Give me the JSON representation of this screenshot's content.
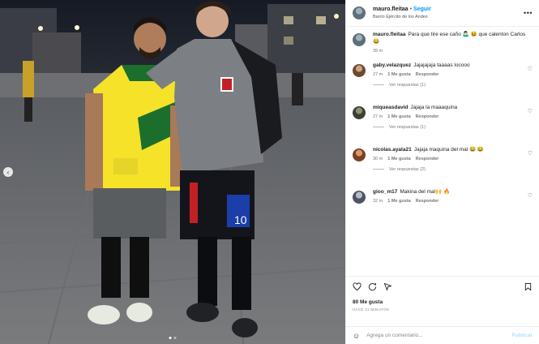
{
  "header": {
    "username": "mauro.fleitaa",
    "separator": "•",
    "follow_label": "Seguir",
    "location": "Barrio Ejército de los Andes",
    "more_icon": "more-horizontal-icon"
  },
  "caption": {
    "username": "mauro.fleitaa",
    "text": "Para que tire ese caño 🤷🏻‍♂️ 😆 que calenton Carlos 😂",
    "time": "39 m"
  },
  "comments": [
    {
      "username": "gaby.velazquez",
      "text": "Jajajajaja taaaas locooo",
      "time": "27 m",
      "likes": "1 Me gusta",
      "reply": "Responder",
      "replies": "Ver respuestas (1)"
    },
    {
      "username": "miqueasdavid",
      "text": "Jajaja la maaaquina",
      "time": "27 m",
      "likes": "1 Me gusta",
      "reply": "Responder",
      "replies": "Ver respuestas (1)"
    },
    {
      "username": "nicolas.ayala21",
      "text": "Jajaja maquina del mal 😂 😂",
      "time": "30 m",
      "likes": "1 Me gusta",
      "reply": "Responder",
      "replies": "Ver respuestas (2)"
    },
    {
      "username": "gioo_m17",
      "text": "Makina del mal🙌 🔥",
      "time": "32 m",
      "likes": "1 Me gusta",
      "reply": "Responder"
    }
  ],
  "actions": {
    "likes": "80 Me gusta",
    "time": "HACE 41 MINUTOS"
  },
  "add_comment": {
    "placeholder": "Agrega un comentario...",
    "publish_label": "Publicar"
  },
  "photo": {
    "jersey_number": "10"
  },
  "colors": {
    "follow": "#0095f6",
    "publish": "#b2dffc"
  }
}
